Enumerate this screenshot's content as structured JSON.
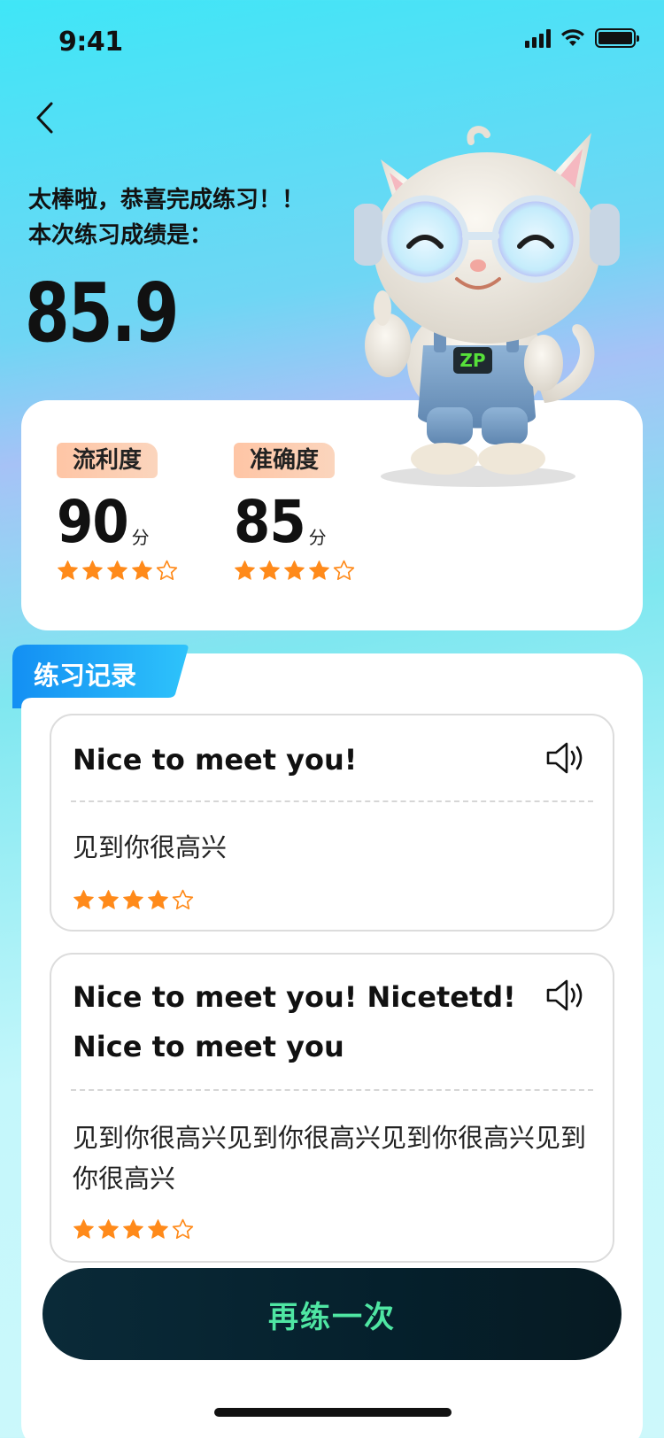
{
  "status_bar": {
    "time": "9:41"
  },
  "header": {
    "congrats": "太棒啦，恭喜完成练习！！",
    "score_caption": "本次练习成绩是：",
    "total_score": "85.9"
  },
  "metrics": [
    {
      "label": "流利度",
      "value": "90",
      "unit": "分",
      "rating": 4,
      "max_rating": 5
    },
    {
      "label": "准确度",
      "value": "85",
      "unit": "分",
      "rating": 4,
      "max_rating": 5
    }
  ],
  "records": {
    "title": "练习记录",
    "items": [
      {
        "english": "Nice to meet you!",
        "chinese": "见到你很高兴",
        "rating": 4,
        "max_rating": 5
      },
      {
        "english": "Nice to meet you!  Nicetetd!  Nice to meet you",
        "chinese": "见到你很高兴见到你很高兴见到你很高兴见到你很高兴",
        "rating": 4,
        "max_rating": 5
      }
    ]
  },
  "retry_button": {
    "label": "再练一次"
  },
  "mascot": {
    "badge": "ZP"
  },
  "colors": {
    "star": "#ff8a1a",
    "accent_blue": "#1aa7f5",
    "button_text": "#4fe6a3",
    "tag_bg": "#fdc8aa"
  }
}
